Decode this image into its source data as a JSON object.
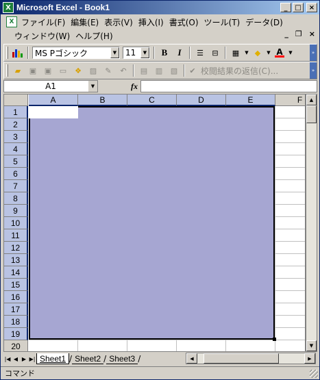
{
  "window": {
    "title": "Microsoft Excel - Book1",
    "app_icon": "X"
  },
  "window_controls": {
    "minimize": "_",
    "maximize": "□",
    "close": "×"
  },
  "doc_controls": {
    "minimize": "_",
    "restore": "❐",
    "close": "×"
  },
  "menu": {
    "row1": [
      "ファイル(F)",
      "編集(E)",
      "表示(V)",
      "挿入(I)",
      "書式(O)",
      "ツール(T)",
      "データ(D)"
    ],
    "row2": [
      "ウィンドウ(W)",
      "ヘルプ(H)"
    ]
  },
  "toolbar": {
    "font_name": "MS Pゴシック",
    "font_size": "11",
    "bold_label": "B",
    "italic_label": "I",
    "font_color_label": "A",
    "review_label": "校閲結果の返信(C)..."
  },
  "formula_bar": {
    "name_box": "A1",
    "fx_label": "fx",
    "formula": ""
  },
  "sheet": {
    "columns": [
      "A",
      "B",
      "C",
      "D",
      "E",
      "F"
    ],
    "rows": [
      "1",
      "2",
      "3",
      "4",
      "5",
      "6",
      "7",
      "8",
      "9",
      "10",
      "11",
      "12",
      "13",
      "14",
      "15",
      "16",
      "17",
      "18",
      "19",
      "20"
    ],
    "selection_range": "A1:E19",
    "selection_color": "#a6a6d2"
  },
  "tabs": [
    "Sheet1",
    "Sheet2",
    "Sheet3"
  ],
  "tab_nav": [
    "|◀",
    "◀",
    "▶",
    "▶|"
  ],
  "status": {
    "text": "コマンド"
  }
}
